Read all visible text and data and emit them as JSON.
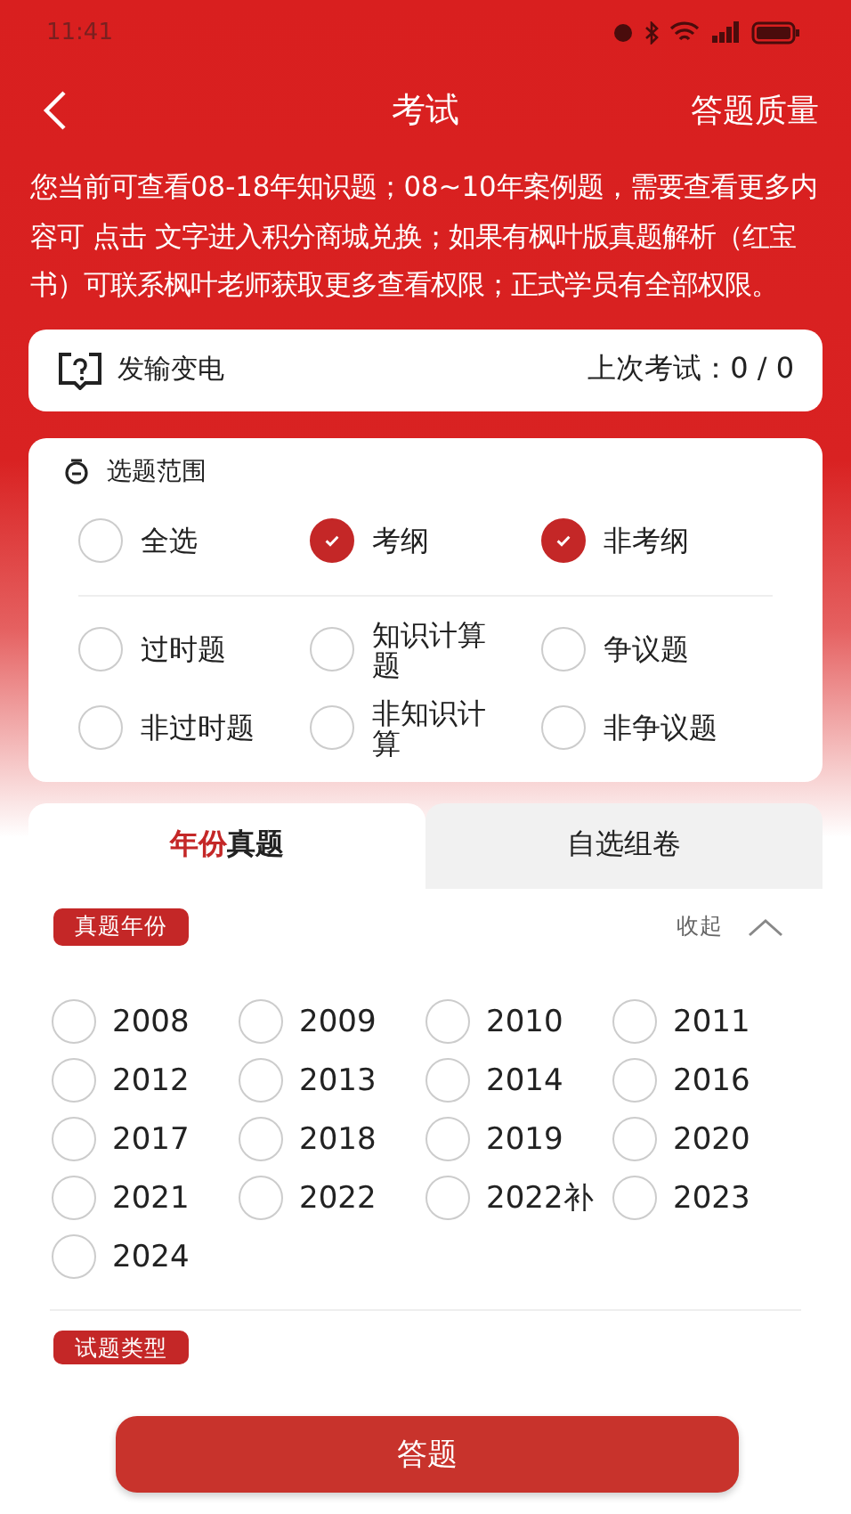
{
  "status_bar": {
    "time": "11:41"
  },
  "header": {
    "title": "考试",
    "action": "答题质量"
  },
  "notice": "您当前可查看08-18年知识题；08~10年案例题，需要查看更多内容可 点击 文字进入积分商城兑换；如果有枫叶版真题解析（红宝书）可联系枫叶老师获取更多查看权限；正式学员有全部权限。",
  "subject": {
    "name": "发输变电",
    "last_exam": "上次考试：0 / 0"
  },
  "scope": {
    "title": "选题范围",
    "rows": [
      [
        {
          "label": "全选",
          "checked": false
        },
        {
          "label": "考纲",
          "checked": true
        },
        {
          "label": "非考纲",
          "checked": true
        }
      ],
      [
        {
          "label": "过时题",
          "checked": false
        },
        {
          "label": "知识计算题",
          "checked": false
        },
        {
          "label": "争议题",
          "checked": false
        }
      ],
      [
        {
          "label": "非过时题",
          "checked": false
        },
        {
          "label": "非知识计算",
          "checked": false
        },
        {
          "label": "非争议题",
          "checked": false
        }
      ]
    ]
  },
  "tabs": [
    {
      "label_accent": "年份",
      "label": "真题",
      "selected": true
    },
    {
      "label": "自选组卷",
      "selected": false
    }
  ],
  "years": {
    "tag": "真题年份",
    "collapse": "收起",
    "items": [
      {
        "label": "2008",
        "checked": false
      },
      {
        "label": "2009",
        "checked": false
      },
      {
        "label": "2010",
        "checked": false
      },
      {
        "label": "2011",
        "checked": false
      },
      {
        "label": "2012",
        "checked": false
      },
      {
        "label": "2013",
        "checked": false
      },
      {
        "label": "2014",
        "checked": false
      },
      {
        "label": "2016",
        "checked": false
      },
      {
        "label": "2017",
        "checked": false
      },
      {
        "label": "2018",
        "checked": false
      },
      {
        "label": "2019",
        "checked": false
      },
      {
        "label": "2020",
        "checked": false
      },
      {
        "label": "2021",
        "checked": false
      },
      {
        "label": "2022",
        "checked": false
      },
      {
        "label": "2022补",
        "checked": false
      },
      {
        "label": "2023",
        "checked": false
      },
      {
        "label": "2024",
        "checked": false
      }
    ]
  },
  "question_type": {
    "tag": "试题类型"
  },
  "submit": "答题"
}
